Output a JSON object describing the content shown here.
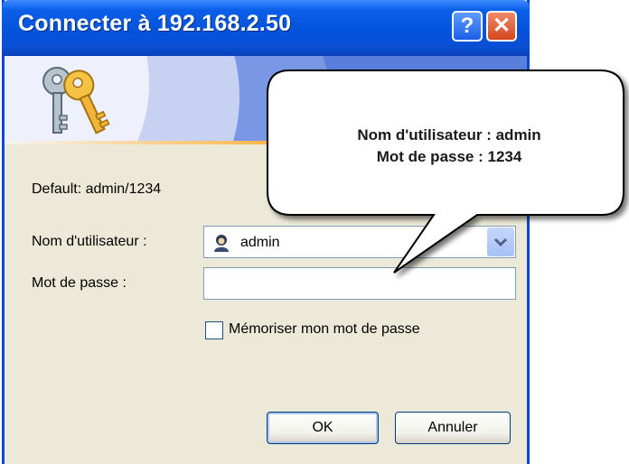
{
  "window": {
    "title": "Connecter à 192.168.2.50",
    "help_label": "?",
    "close_label": "✕"
  },
  "banner": {
    "icon": "keys-icon"
  },
  "form": {
    "default_text": "Default: admin/1234",
    "username_label": "Nom d'utilisateur :",
    "username_value": "admin",
    "password_label": "Mot de passe :",
    "password_value": "",
    "remember_label": "Mémoriser mon mot de passe",
    "remember_checked": false
  },
  "buttons": {
    "ok": "OK",
    "cancel": "Annuler"
  },
  "callout": {
    "line1": "Nom d'utilisateur : admin",
    "line2": "Mot de passe : 1234"
  },
  "colors": {
    "titlebar": "#0453dc",
    "dialog_bg": "#ece9d8",
    "close_button": "#d5461e"
  }
}
